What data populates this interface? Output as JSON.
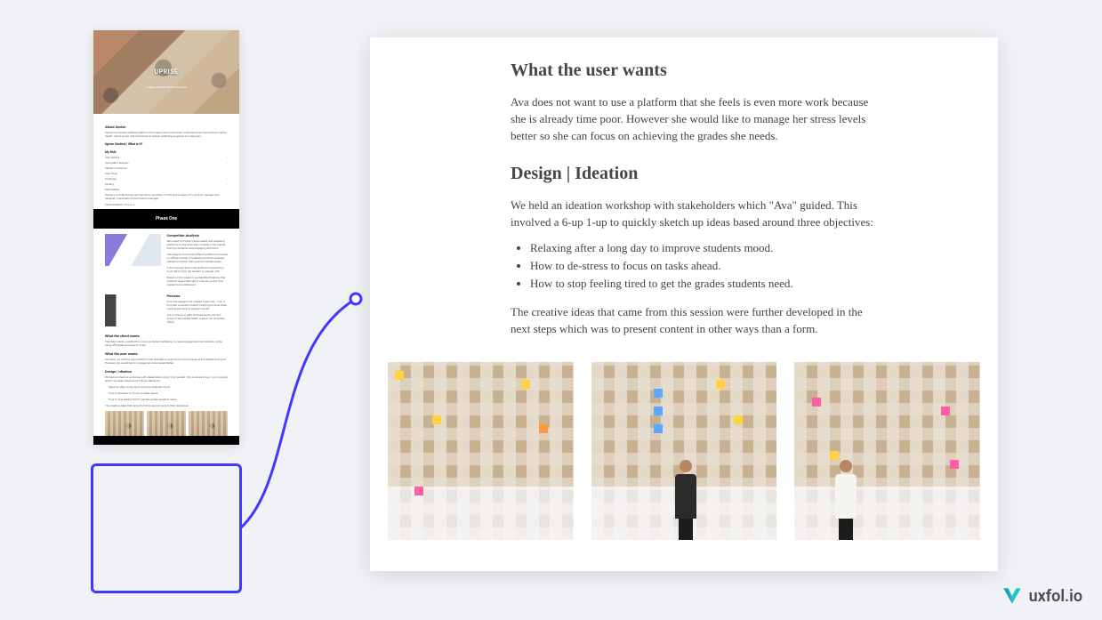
{
  "mini": {
    "hero": {
      "title": "UPRISE",
      "subtitle": "Helping students all over the world"
    },
    "about": {
      "heading": "About Uprise",
      "para1": "Uprise is a mental wellbeing platform that helps users proactively understand and improve their mental health. Uprise works with businesses to deliver wellbeing programs to employees.",
      "para2": "Uprise Student | What is it?",
      "listHeading": "My Role",
      "items": [
        {
          "label": "User testing",
          "value": ""
        },
        {
          "label": "Competitor analysis",
          "value": ""
        },
        {
          "label": "Ideation workshop",
          "value": ""
        },
        {
          "label": "User flows",
          "value": ""
        },
        {
          "label": "Prototype",
          "value": ""
        },
        {
          "label": "Testing",
          "value": ""
        },
        {
          "label": "Deliverables",
          "value": ""
        }
      ],
      "para3": "Uprise is a small startup and the team consisted of: CEO and founder, CTO, product manager and designer. I reported into the product manager.",
      "para4": "Client Situation: This is a…"
    },
    "phase": "Phase One",
    "comp": {
      "heading": "Competitor Analysis",
      "para1": "We looked at similar mental health and wellbeing platforms to see what was currently in the market and how students were engaging with them.",
      "para2": "The analysis found that different platforms focused on different areas of wellbeing and that students wanted a solution that covered multiple bases.",
      "para3": "It also showed that some platforms required too much effort from the student to engage with.",
      "para4": "Based on this research we identified features that students responded well to and pain points that needed to be addressed."
    },
    "persona": {
      "heading": "Persona",
      "para1": "From the research we created a persona – Ava. A first year university student studying full time while working part time to support herself.",
      "para2": "Ava is time poor, gets stressed easily and isn't aware of the mental health support her university offers."
    },
    "client": {
      "heading": "What the client wants",
      "para": "The client wants a platform to improve student wellbeing, increase engagement and retention while being affordable and easy to scale."
    },
    "user": {
      "heading": "What the user wants",
      "para": "Ava does not want to use a platform that she feels is even more work because she is already time poor. However she would like to manage her stress levels better."
    },
    "ideation": {
      "heading": "Design | Ideation",
      "para1": "We held an ideation workshop with stakeholders which \"Ava\" guided. This involved a 6-up 1-up to quickly sketch up ideas based around three objectives:",
      "b1": "Relaxing after a long day to improve students mood.",
      "b2": "How to de-stress to focus on tasks ahead.",
      "b3": "How to stop feeling tired to get the grades students need.",
      "para2": "The creative ideas that came from this session were further developed."
    }
  },
  "detail": {
    "h1": "What the user wants",
    "p1": "Ava does not want to use a platform that she feels is even more work because she is already time poor. However she would like to manage her stress levels better so she can focus on achieving the grades she needs.",
    "h2": "Design | Ideation",
    "p2": "We held an ideation workshop with stakeholders which \"Ava\" guided. This involved a 6-up 1-up to quickly sketch up ideas based around three objectives:",
    "b1": "Relaxing after a long day to improve students mood.",
    "b2": "How to de-stress to focus on tasks ahead.",
    "b3": "How to stop feeling tired to get the grades students need.",
    "p3": "The creative ideas that came from this session were further developed in the next steps which was to present content in other ways than a form."
  },
  "watermark": {
    "text": "uxfol.io"
  }
}
